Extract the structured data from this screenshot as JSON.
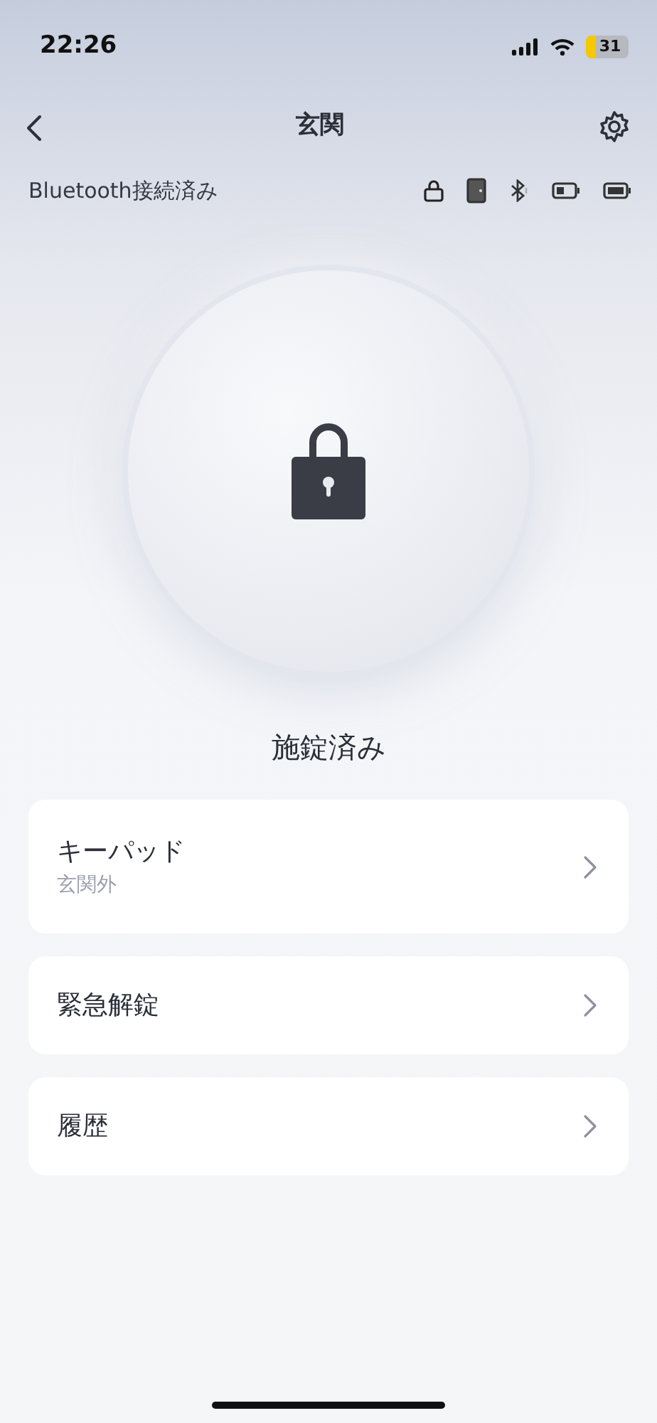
{
  "status_bar": {
    "time": "22:26",
    "battery": "31"
  },
  "nav": {
    "title": "玄関"
  },
  "connection": {
    "text": "Bluetooth接続済み"
  },
  "lock": {
    "locked": true,
    "status": "施錠済み"
  },
  "menu": [
    {
      "title": "キーパッド",
      "subtitle": "玄関外"
    },
    {
      "title": "緊急解錠"
    },
    {
      "title": "履歴"
    }
  ]
}
